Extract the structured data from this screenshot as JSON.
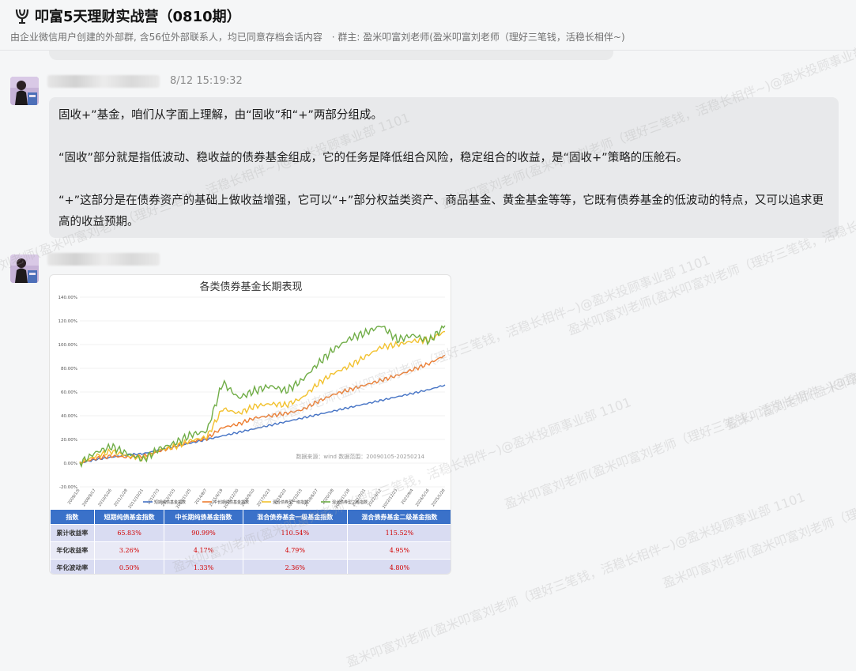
{
  "header": {
    "title": "叩富5天理财实战营（0810期）",
    "description": "由企业微信用户创建的外部群, 含56位外部联系人，均已同意存档会话内容",
    "group_owner": "· 群主: 盈米叩富刘老师(盈米叩富刘老师（理好三笔钱，活稳长相伴~)"
  },
  "messages": [
    {
      "timestamp": "8/12 15:19:32",
      "paragraphs": [
        "固收+”基金，咱们从字面上理解，由“固收”和“+”两部分组成。",
        "“固收”部分就是指低波动、稳收益的债券基金组成，它的任务是降低组合风险，稳定组合的收益，是“固收+”策略的压舱石。",
        "“+”这部分是在债券资产的基础上做收益增强，它可以“+”部分权益类资产、商品基金、黄金基金等等，它既有债券基金的低波动的特点，又可以追求更高的收益预期。"
      ]
    }
  ],
  "chart_data": {
    "type": "line",
    "title": "各类债券基金长期表现",
    "source_note": "数据来源：wind 数据范围：20090105-20250214",
    "x": [
      "2009/1/5",
      "2009/9/17",
      "2010/5/26",
      "2011/1/28",
      "2011/10/21",
      "2012/7/3",
      "2013/3/15",
      "2013/11/25",
      "2014/8/7",
      "2015/4/19",
      "2015/12/30",
      "2016/9/10",
      "2017/5/23",
      "2018/2/2",
      "2018/10/15",
      "2019/6/27",
      "2020/3/8",
      "2020/11/18",
      "2021/7/31",
      "2022/4/12",
      "2022/12/23",
      "2023/9/4",
      "2024/5/16",
      "2025/1/26"
    ],
    "ylim": [
      -20,
      140
    ],
    "yticks": [
      "-20.00%",
      "0.00%",
      "20.00%",
      "40.00%",
      "60.00%",
      "80.00%",
      "100.00%",
      "120.00%",
      "140.00%"
    ],
    "series": [
      {
        "name": "短期纯债基金指数",
        "color": "#4472c4",
        "values": [
          0,
          3,
          5,
          7,
          8,
          11,
          14,
          17,
          20,
          23,
          26,
          29,
          32,
          35,
          38,
          41,
          44,
          47,
          50,
          53,
          56,
          59,
          62,
          66
        ]
      },
      {
        "name": "中长期纯债基金指数",
        "color": "#ed7d31",
        "values": [
          0,
          4,
          6,
          5,
          6,
          10,
          14,
          18,
          21,
          30,
          33,
          38,
          40,
          42,
          45,
          52,
          58,
          62,
          66,
          70,
          74,
          79,
          84,
          91
        ]
      },
      {
        "name": "混合债券型一级指数",
        "color": "#f2c12e",
        "values": [
          0,
          6,
          10,
          6,
          4,
          11,
          14,
          19,
          22,
          46,
          42,
          48,
          50,
          49,
          55,
          67,
          76,
          82,
          90,
          98,
          100,
          103,
          104,
          111
        ]
      },
      {
        "name": "混合债券型二级指数",
        "color": "#70ad47",
        "values": [
          0,
          9,
          14,
          8,
          3,
          12,
          17,
          24,
          27,
          68,
          55,
          61,
          65,
          61,
          70,
          84,
          96,
          105,
          110,
          116,
          104,
          108,
          103,
          116
        ]
      }
    ]
  },
  "table": {
    "headers": [
      "指数",
      "短期纯债基金指数",
      "中长期纯债基金指数",
      "混合债券基金一级基金指数",
      "混合债券基金二级基金指数"
    ],
    "rows": [
      [
        "累计收益率",
        "65.83%",
        "90.99%",
        "110.54%",
        "115.52%"
      ],
      [
        "年化收益率",
        "3.26%",
        "4.17%",
        "4.79%",
        "4.95%"
      ],
      [
        "年化波动率",
        "0.50%",
        "1.33%",
        "2.36%",
        "4.80%"
      ]
    ]
  },
  "watermark": "盈米叩富刘老师(盈米叩富刘老师（理好三笔钱，活稳长相伴~)@盈米投顾事业部 1101"
}
